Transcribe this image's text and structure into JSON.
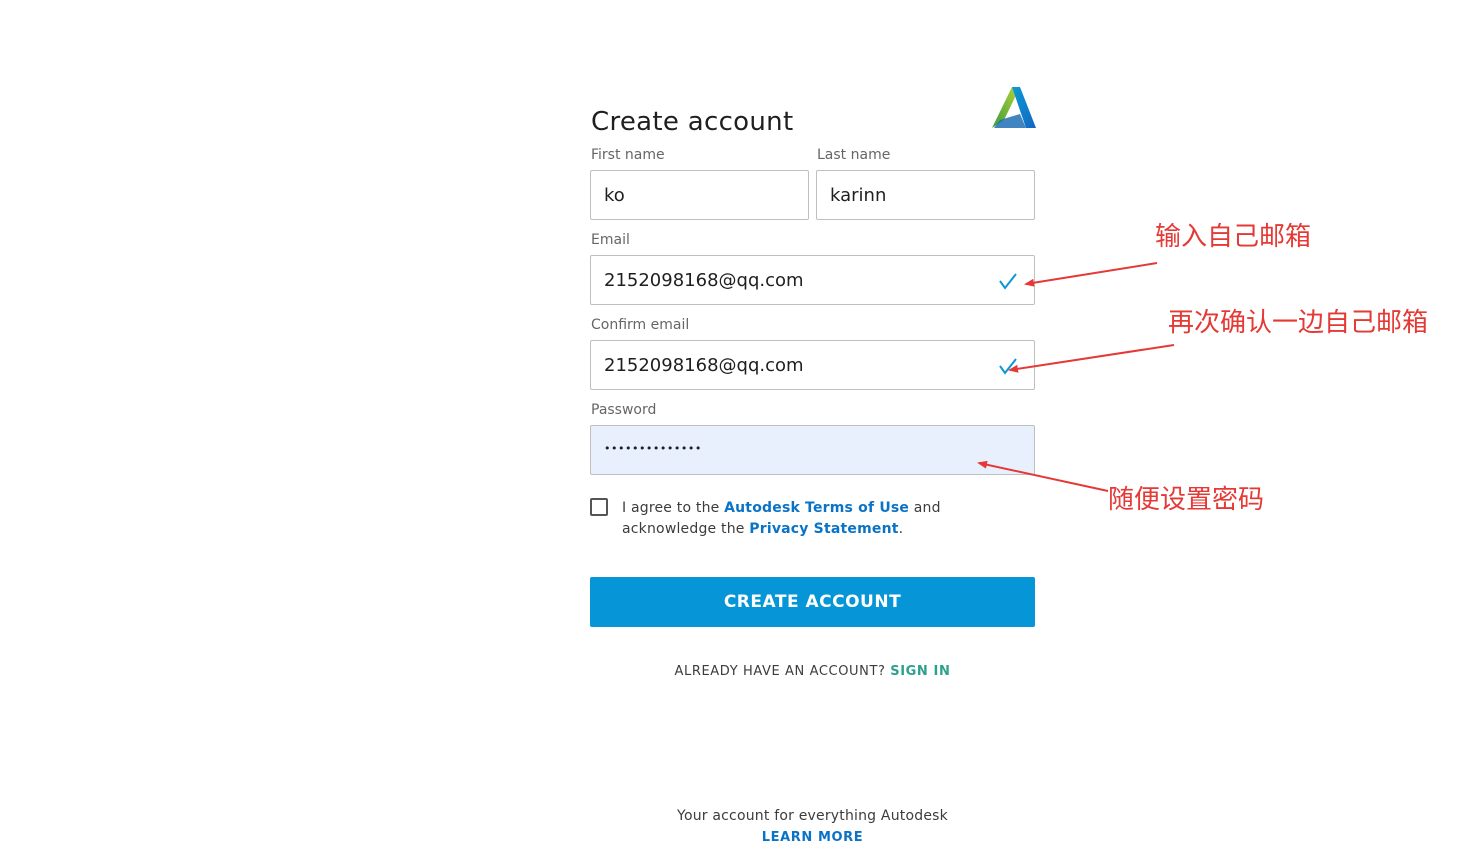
{
  "form": {
    "title": "Create account",
    "first_name_label": "First name",
    "first_name_value": "ko",
    "last_name_label": "Last name",
    "last_name_value": "karinn",
    "email_label": "Email",
    "email_value": "2152098168@qq.com",
    "confirm_email_label": "Confirm email",
    "confirm_email_value": "2152098168@qq.com",
    "password_label": "Password",
    "password_value": "••••••••••••••",
    "agree_prefix": "I agree to the ",
    "terms_link": "Autodesk Terms of Use",
    "agree_middle": " and acknowledge the ",
    "privacy_link": "Privacy Statement",
    "agree_suffix": ".",
    "submit_label": "CREATE ACCOUNT",
    "already_text": "ALREADY HAVE AN ACCOUNT?",
    "sign_in_link": "SIGN IN"
  },
  "footer": {
    "tagline": "Your account for everything Autodesk",
    "learn_more": "LEARN MORE"
  },
  "annotations": {
    "email_note": "输入自己邮箱",
    "confirm_note": "再次确认一边自己邮箱",
    "password_note": "随便设置密码"
  },
  "icons": {
    "logo": "autodesk-logo",
    "valid": "checkmark-icon"
  },
  "colors": {
    "primary_button": "#0696d7",
    "link": "#0a73c6",
    "sign_in": "#2ba18e",
    "annotation": "#e53935",
    "password_autofill_bg": "#e8f0fe"
  }
}
